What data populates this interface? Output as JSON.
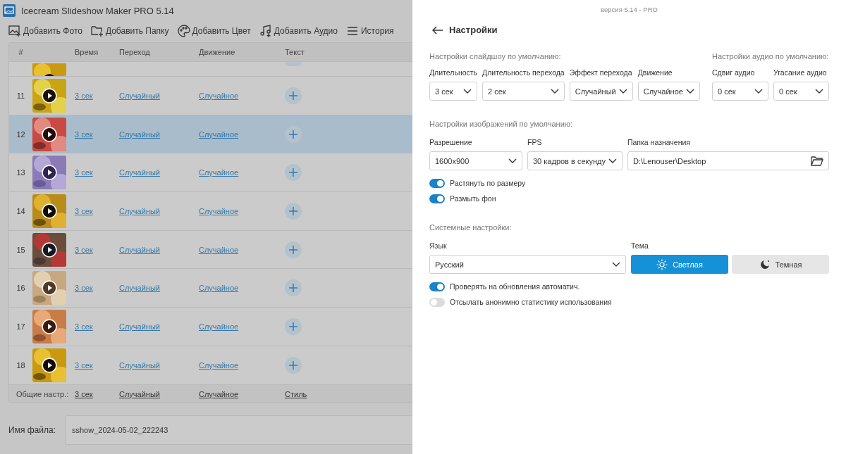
{
  "window": {
    "title": "Icecream Slideshow Maker PRO 5.14"
  },
  "toolbar": [
    {
      "label": "Добавить Фото"
    },
    {
      "label": "Добавить Папку",
      "kind": "folder"
    },
    {
      "label": "Добавить Цвет",
      "kind": "palette"
    },
    {
      "label": "Добавить Аудио",
      "kind": "audio"
    },
    {
      "label": "История",
      "kind": "menu"
    }
  ],
  "table": {
    "columns": [
      "#",
      "Время",
      "Переход",
      "Движение",
      "Текст"
    ],
    "rows": [
      {
        "number": "11",
        "time": "3 сек",
        "transition": "Случайный",
        "motion": "Случайное",
        "selected": false
      },
      {
        "number": "12",
        "time": "3 сек",
        "transition": "Случайный",
        "motion": "Случайное",
        "selected": true
      },
      {
        "number": "13",
        "time": "3 сек",
        "transition": "Случайный",
        "motion": "Случайное",
        "selected": false
      },
      {
        "number": "14",
        "time": "3 сек",
        "transition": "Случайный",
        "motion": "Случайное",
        "selected": false
      },
      {
        "number": "15",
        "time": "3 сек",
        "transition": "Случайный",
        "motion": "Случайное",
        "selected": false
      },
      {
        "number": "16",
        "time": "3 сек",
        "transition": "Случайный",
        "motion": "Случайное",
        "selected": false
      },
      {
        "number": "17",
        "time": "3 сек",
        "transition": "Случайный",
        "motion": "Случайное",
        "selected": false
      },
      {
        "number": "18",
        "time": "3 сек",
        "transition": "Случайный",
        "motion": "Случайное",
        "selected": false
      }
    ],
    "footer": {
      "label": "Общие настр.:",
      "time": "3 сек",
      "transition": "Случайный",
      "motion": "Случайное",
      "text": "Стиль"
    }
  },
  "file_name": {
    "label": "Имя файла:",
    "value": "sshow_2024-05-02_222243"
  },
  "settings": {
    "version": "версия 5.14 - PRO",
    "title": "Настройки",
    "slideshow": {
      "heading": "Настройки слайдшоу по умолчанию:",
      "fields": [
        {
          "label": "Длительность",
          "value": "3 сек"
        },
        {
          "label": "Длительность перехода",
          "value": "2 сек"
        },
        {
          "label": "Эффект перехода",
          "value": "Случайный"
        },
        {
          "label": "Движение",
          "value": "Случайное"
        }
      ]
    },
    "audio": {
      "heading": "Настройки аудио по умолчанию:",
      "fields": [
        {
          "label": "Сдвиг аудио",
          "value": "0 сек"
        },
        {
          "label": "Угасание аудио",
          "value": "0 сек"
        }
      ]
    },
    "images": {
      "heading": "Настройки изображений по умолчанию:",
      "fields": [
        {
          "label": "Разрешение",
          "value": "1600x900",
          "kind": "select"
        },
        {
          "label": "FPS",
          "value": "30 кадров в секунду",
          "kind": "select"
        },
        {
          "label": "Папка назначения",
          "value": "D:\\Lenouser\\Desktop",
          "kind": "path"
        }
      ],
      "toggles": [
        {
          "label": "Растянуть по размеру",
          "on": true
        },
        {
          "label": "Размыть фон",
          "on": true
        }
      ]
    },
    "system": {
      "heading": "Системные настройки:",
      "language": {
        "label": "Язык",
        "value": "Русский"
      },
      "theme": {
        "label": "Тема",
        "options": [
          {
            "label": "Светлая",
            "kind": "light",
            "selected": true
          },
          {
            "label": "Темная",
            "kind": "dark",
            "selected": false
          }
        ]
      },
      "toggles": [
        {
          "label": "Проверять на обновления автоматич.",
          "on": true
        },
        {
          "label": "Отсылать анонимно статистику использования",
          "on": false
        }
      ]
    }
  }
}
